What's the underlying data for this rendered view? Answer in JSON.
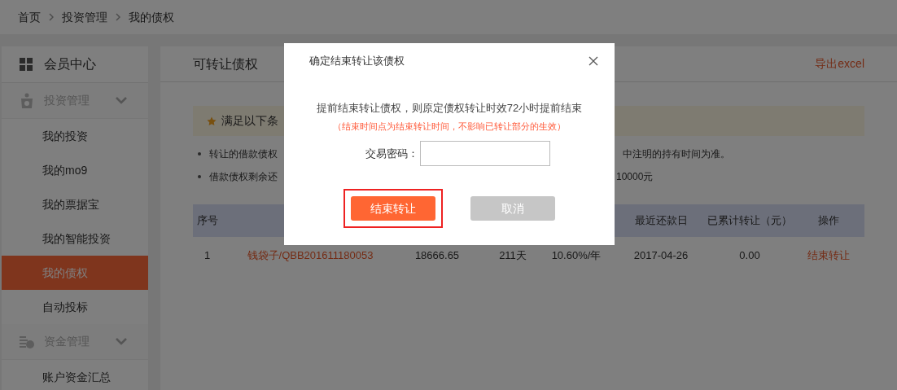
{
  "breadcrumb": [
    "首页",
    "投资管理",
    "我的债权"
  ],
  "sidebar": {
    "header": "会员中心",
    "groups": [
      {
        "label": "投资管理",
        "expanded": true,
        "items": [
          {
            "label": "我的投资",
            "selected": false
          },
          {
            "label": "我的mo9",
            "selected": false
          },
          {
            "label": "我的票据宝",
            "selected": false
          },
          {
            "label": "我的智能投资",
            "selected": false
          },
          {
            "label": "我的债权",
            "selected": true
          },
          {
            "label": "自动投标",
            "selected": false
          }
        ]
      },
      {
        "label": "资金管理",
        "expanded": true,
        "items": [
          {
            "label": "账户资金汇总",
            "selected": false
          }
        ]
      }
    ]
  },
  "main": {
    "title": "可转让债权",
    "export_link": "导出excel",
    "notice": "满足以下条",
    "bullets": [
      {
        "left": "转让的借款债权",
        "right": "中注明的持有时间为准。"
      },
      {
        "left": "借款债权剩余还",
        "right": "10000元"
      }
    ],
    "table": {
      "columns_left": [
        "序号"
      ],
      "columns_right": [
        "最近还款日",
        "已累计转让（元）",
        "操作"
      ],
      "rows": [
        {
          "cells": [
            "1",
            "钱袋子/QBB201611180053",
            "18666.65",
            "211天",
            "10.60%/年",
            "2017-04-26",
            "0.00"
          ],
          "action": "结束转让"
        }
      ]
    }
  },
  "dialog": {
    "title": "确定结束转让该债权",
    "message": "提前结束转让债权，则原定债权转让时效72小时提前结束",
    "note": "（结束时间点为结束转让时间，不影响已转让部分的生效）",
    "field_label": "交易密码：",
    "buttons": [
      {
        "label": "结束转让",
        "kind": "primary",
        "highlighted": true
      },
      {
        "label": "取消",
        "kind": "cancel",
        "highlighted": false
      }
    ]
  }
}
